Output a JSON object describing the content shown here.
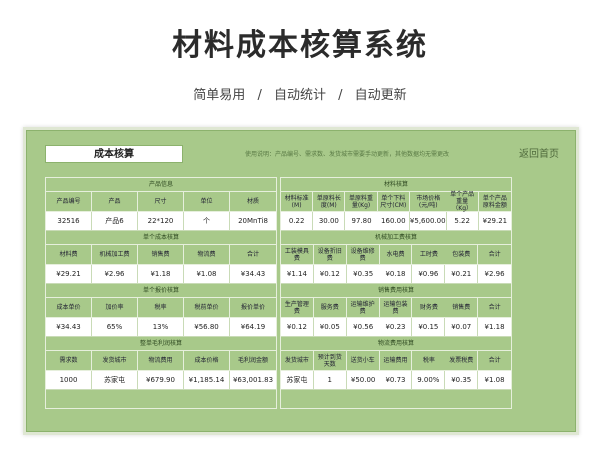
{
  "header": {
    "title": "材料成本核算系统",
    "sub": [
      "简单易用",
      "/",
      "自动统计",
      "/",
      "自动更新"
    ]
  },
  "sheet": {
    "title": "成本核算",
    "usage": "使用说明：产品编号、需求数、发货城市需要手动更新，其他数据均无需更改",
    "back": "返回首页"
  },
  "left": [
    {
      "title": "产品信息",
      "headers": [
        "产品编号",
        "产品",
        "尺寸",
        "单位",
        "材质"
      ],
      "values": [
        "32516",
        "产品6",
        "22*120",
        "个",
        "20MnTi8"
      ]
    },
    {
      "title": "单个成本核算",
      "headers": [
        "材料费",
        "机械加工费",
        "销售费",
        "物流费",
        "合计"
      ],
      "values": [
        "¥29.21",
        "¥2.96",
        "¥1.18",
        "¥1.08",
        "¥34.43"
      ]
    },
    {
      "title": "单个报价核算",
      "headers": [
        "成本单价",
        "加价率",
        "税率",
        "税前单价",
        "报价单价"
      ],
      "values": [
        "¥34.43",
        "65%",
        "13%",
        "¥56.80",
        "¥64.19"
      ]
    },
    {
      "title": "整单毛利润核算",
      "headers": [
        "需求数",
        "发货城市",
        "物流费用",
        "成本价格",
        "毛利润金额"
      ],
      "values": [
        "1000",
        "苏家屯",
        "¥679.90",
        "¥1,185.14",
        "¥63,001.83"
      ]
    }
  ],
  "right": [
    {
      "title": "材料核算",
      "headers": [
        "材料标准(M)",
        "单原料长度(M)",
        "单原料重量(Kg)",
        "单个下料尺寸(CM)",
        "市场价格(元/吨)",
        "单个产品重量（Kg）",
        "单个产品原料金额"
      ],
      "values": [
        "0.22",
        "30.00",
        "97.80",
        "160.00",
        "¥5,600.00",
        "5.22",
        "¥29.21"
      ]
    },
    {
      "title": "机械加工费核算",
      "headers": [
        "工装模具费",
        "设备折旧费",
        "设备维修费",
        "水电费",
        "工时费",
        "包装费",
        "合计"
      ],
      "values": [
        "¥1.14",
        "¥0.12",
        "¥0.35",
        "¥0.18",
        "¥0.96",
        "¥0.21",
        "¥2.96"
      ]
    },
    {
      "title": "销售费用核算",
      "headers": [
        "生产管理费",
        "服务费",
        "运输维护费",
        "运输包装费",
        "财务费",
        "销售费",
        "合计"
      ],
      "values": [
        "¥0.12",
        "¥0.05",
        "¥0.56",
        "¥0.23",
        "¥0.15",
        "¥0.07",
        "¥1.18"
      ]
    },
    {
      "title": "物流费用核算",
      "headers": [
        "发货城市",
        "预计到货天数",
        "送货小车",
        "运输费用",
        "税率",
        "发票税费",
        "合计"
      ],
      "values": [
        "苏家屯",
        "1",
        "¥50.00",
        "¥0.73",
        "9.00%",
        "¥0.35",
        "¥1.08"
      ]
    }
  ]
}
